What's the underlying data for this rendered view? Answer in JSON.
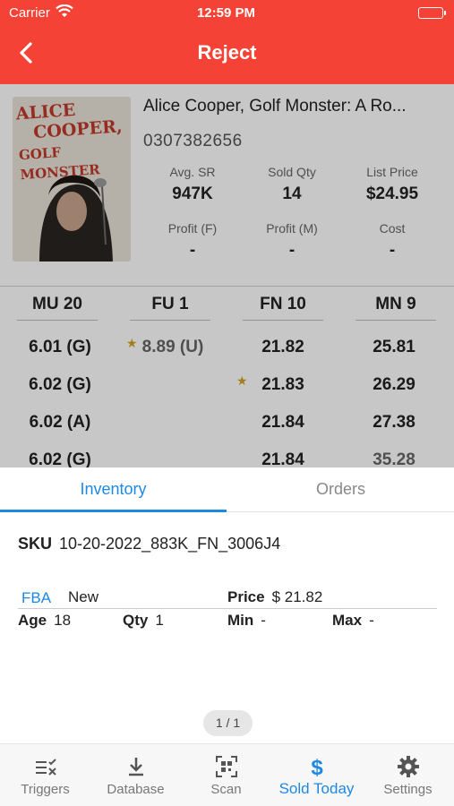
{
  "status_bar": {
    "carrier": "Carrier",
    "time": "12:59 PM"
  },
  "nav": {
    "title": "Reject",
    "back_icon": "chevron-left-icon"
  },
  "product": {
    "title": "Alice Cooper, Golf Monster: A Ro...",
    "isbn": "0307382656",
    "cover_text": [
      "ALICE",
      "COOPER,",
      "GOLF MONSTER"
    ],
    "stats": [
      {
        "label": "Avg. SR",
        "value": "947K"
      },
      {
        "label": "Sold Qty",
        "value": "14"
      },
      {
        "label": "List Price",
        "value": "$24.95"
      },
      {
        "label": "Profit (F)",
        "value": "-"
      },
      {
        "label": "Profit (M)",
        "value": "-"
      },
      {
        "label": "Cost",
        "value": "-"
      }
    ]
  },
  "offers": {
    "headers": [
      "MU 20",
      "FU 1",
      "FN 10",
      "MN 9"
    ],
    "rows": [
      [
        "6.01 (G)",
        "8.89 (U)",
        "21.82",
        "25.81"
      ],
      [
        "6.02 (G)",
        "",
        "21.83",
        "26.29"
      ],
      [
        "6.02 (A)",
        "",
        "21.84",
        "27.38"
      ],
      [
        "6.02 (G)",
        "",
        "21.84",
        "35.28"
      ]
    ]
  },
  "sheet": {
    "tabs": [
      "Inventory",
      "Orders"
    ],
    "sku_label": "SKU",
    "sku_value": "10-20-2022_883K_FN_3006J4",
    "channel": "FBA",
    "condition": "New",
    "price_label": "Price",
    "price_value": "$ 21.82",
    "age_label": "Age",
    "age_value": "18",
    "qty_label": "Qty",
    "qty_value": "1",
    "min_label": "Min",
    "min_value": "-",
    "max_label": "Max",
    "max_value": "-",
    "pager": "1 / 1"
  },
  "tabbar": [
    {
      "label": "Triggers",
      "icon": "triggers-icon"
    },
    {
      "label": "Database",
      "icon": "download-icon"
    },
    {
      "label": "Scan",
      "icon": "qr-scan-icon"
    },
    {
      "label": "Sold Today",
      "icon": "dollar-icon",
      "active": true
    },
    {
      "label": "Settings",
      "icon": "gear-icon"
    }
  ],
  "colors": {
    "accent": "#f44336",
    "link": "#1e88e5",
    "star": "#d4a11e"
  }
}
